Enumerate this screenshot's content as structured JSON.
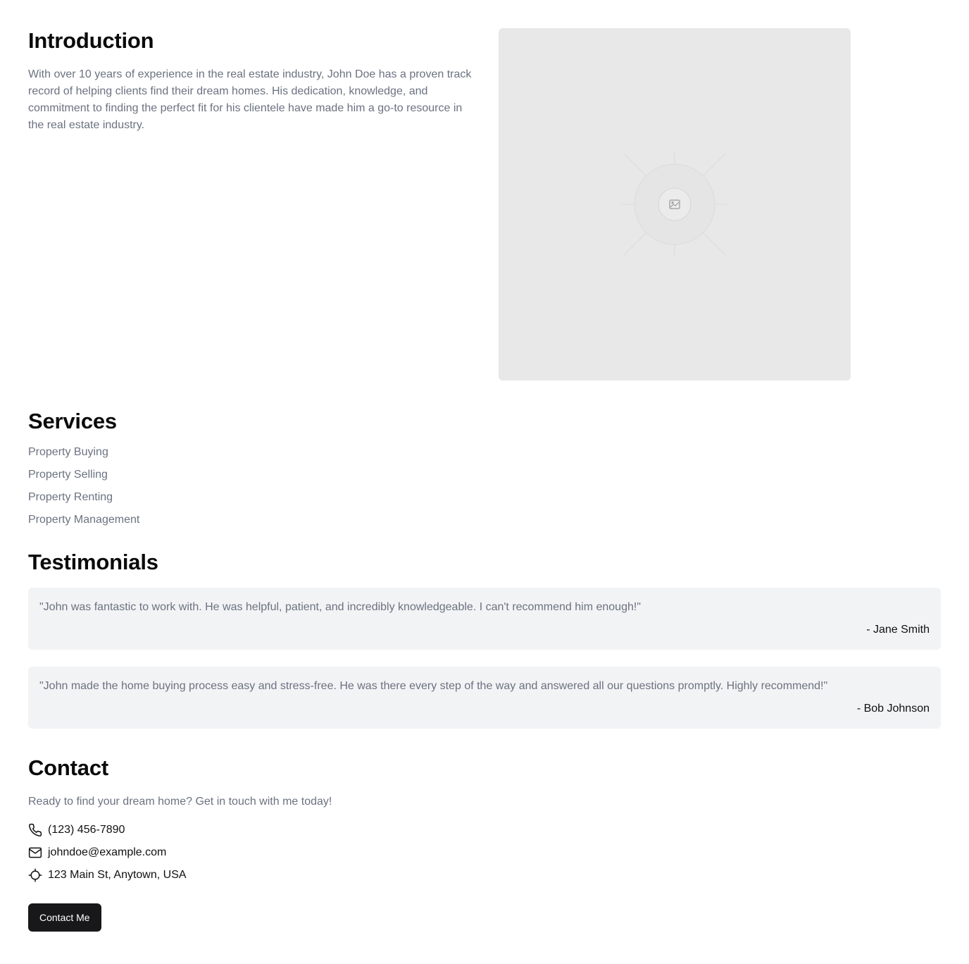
{
  "intro": {
    "title": "Introduction",
    "body": "With over 10 years of experience in the real estate industry, John Doe has a proven track record of helping clients find their dream homes. His dedication, knowledge, and commitment to finding the perfect fit for his clientele have made him a go-to resource in the real estate industry.",
    "image_icon": "image-icon"
  },
  "services": {
    "title": "Services",
    "items": [
      "Property Buying",
      "Property Selling",
      "Property Renting",
      "Property Management"
    ]
  },
  "testimonials": {
    "title": "Testimonials",
    "items": [
      {
        "quote": "\"John was fantastic to work with. He was helpful, patient, and incredibly knowledgeable. I can't recommend him enough!\"",
        "author": "- Jane Smith"
      },
      {
        "quote": "\"John made the home buying process easy and stress-free. He was there every step of the way and answered all our questions promptly. Highly recommend!\"",
        "author": "- Bob Johnson"
      }
    ]
  },
  "contact": {
    "title": "Contact",
    "lead": "Ready to find your dream home? Get in touch with me today!",
    "phone": "(123) 456-7890",
    "email": "johndoe@example.com",
    "address": "123 Main St, Anytown, USA",
    "button_label": "Contact Me",
    "icons": [
      "phone-icon",
      "mail-icon",
      "location-icon"
    ]
  },
  "colors": {
    "muted_text": "#6b7280",
    "card_bg": "#f2f3f5",
    "placeholder_bg": "#e8e8e8",
    "button_bg": "#18181b"
  }
}
